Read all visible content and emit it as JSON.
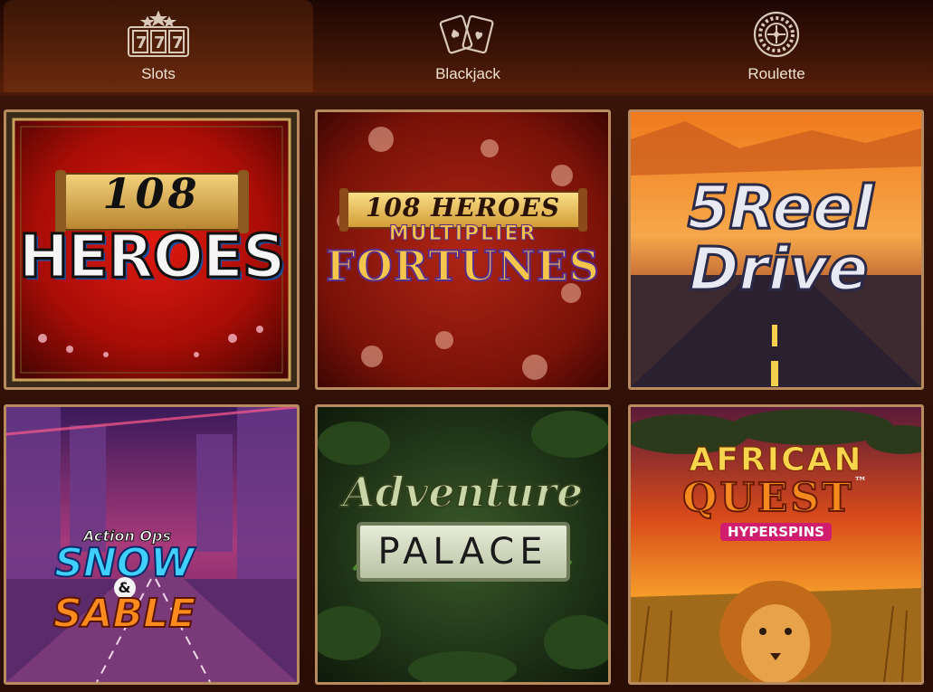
{
  "tabs": [
    {
      "label": "Slots",
      "icon": "slot-machine-777-icon",
      "active": true
    },
    {
      "label": "Blackjack",
      "icon": "playing-cards-icon",
      "active": false
    },
    {
      "label": "Roulette",
      "icon": "roulette-wheel-icon",
      "active": false
    }
  ],
  "games": [
    {
      "line1": "108",
      "line2": "HEROES"
    },
    {
      "line1": "108 HEROES",
      "line2": "MULTIPLIER",
      "line3": "FORTUNES"
    },
    {
      "line1": "5Reel",
      "line2": "Drive"
    },
    {
      "line1": "Action Ops",
      "line2": "SNOW",
      "amp": "&",
      "line3": "SABLE"
    },
    {
      "line1": "Adventure",
      "line2": "PALACE"
    },
    {
      "line1": "AFRICAN",
      "line2": "QUEST",
      "tm": "™",
      "line3": "HYPERSPINS"
    }
  ],
  "colors": {
    "tab_active_bg": "#6b2a0e",
    "tile_border": "#b88b5e",
    "tab_label": "#efe2d4"
  }
}
